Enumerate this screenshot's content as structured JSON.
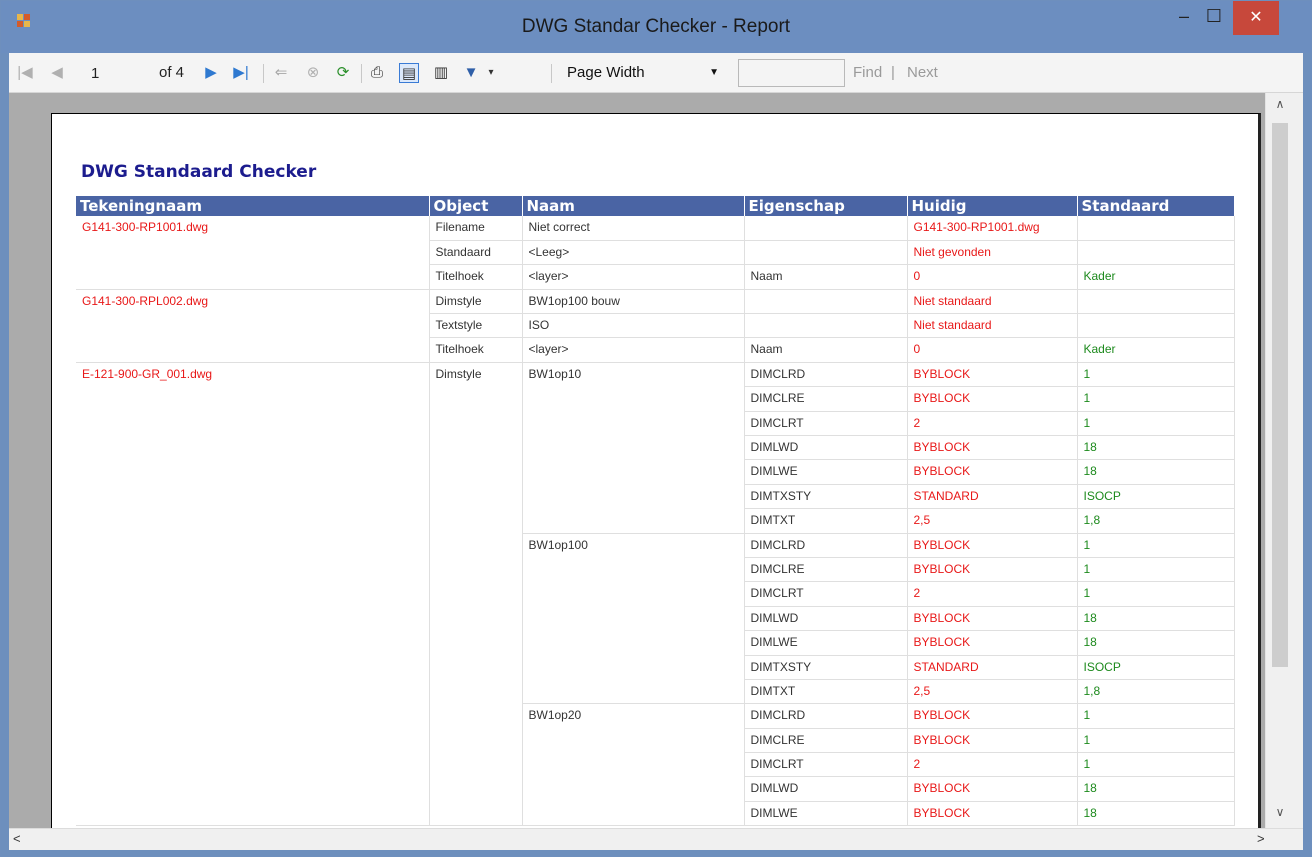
{
  "window": {
    "title": "DWG Standar Checker - Report",
    "close_symbol": "✕",
    "min_symbol": "–",
    "max_symbol": "☐"
  },
  "toolbar": {
    "current_page": "1",
    "page_count": "of 4",
    "zoom": "Page Width",
    "find_label": "Find",
    "find_separator": "|",
    "next_label": "Next"
  },
  "report": {
    "title": "DWG Standaard Checker",
    "columns": [
      "Tekeningnaam",
      "Object",
      "Naam",
      "Eigenschap",
      "Huidig",
      "Standaard"
    ],
    "rows": [
      [
        "G141-300-RP1001.dwg",
        "Filename",
        "Niet correct",
        "",
        "G141-300-RP1001.dwg",
        ""
      ],
      [
        "",
        "Standaard",
        "<Leeg>",
        "",
        "Niet gevonden",
        ""
      ],
      [
        "",
        "Titelhoek",
        "<layer>",
        "Naam",
        "0",
        "Kader"
      ],
      [
        "G141-300-RPL002.dwg",
        "Dimstyle",
        "BW1op100 bouw",
        "",
        "Niet standaard",
        ""
      ],
      [
        "",
        "Textstyle",
        "ISO",
        "",
        "Niet standaard",
        ""
      ],
      [
        "",
        "Titelhoek",
        "<layer>",
        "Naam",
        "0",
        "Kader"
      ],
      [
        "E-121-900-GR_001.dwg",
        "Dimstyle",
        "BW1op10",
        "DIMCLRD",
        "BYBLOCK",
        "1"
      ],
      [
        "",
        "",
        "",
        "DIMCLRE",
        "BYBLOCK",
        "1"
      ],
      [
        "",
        "",
        "",
        "DIMCLRT",
        "2",
        "1"
      ],
      [
        "",
        "",
        "",
        "DIMLWD",
        "BYBLOCK",
        "18"
      ],
      [
        "",
        "",
        "",
        "DIMLWE",
        "BYBLOCK",
        "18"
      ],
      [
        "",
        "",
        "",
        "DIMTXSTY",
        "STANDARD",
        "ISOCP"
      ],
      [
        "",
        "",
        "",
        "DIMTXT",
        "2,5",
        "1,8"
      ],
      [
        "",
        "",
        "BW1op100",
        "DIMCLRD",
        "BYBLOCK",
        "1"
      ],
      [
        "",
        "",
        "",
        "DIMCLRE",
        "BYBLOCK",
        "1"
      ],
      [
        "",
        "",
        "",
        "DIMCLRT",
        "2",
        "1"
      ],
      [
        "",
        "",
        "",
        "DIMLWD",
        "BYBLOCK",
        "18"
      ],
      [
        "",
        "",
        "",
        "DIMLWE",
        "BYBLOCK",
        "18"
      ],
      [
        "",
        "",
        "",
        "DIMTXSTY",
        "STANDARD",
        "ISOCP"
      ],
      [
        "",
        "",
        "",
        "DIMTXT",
        "2,5",
        "1,8"
      ],
      [
        "",
        "",
        "BW1op20",
        "DIMCLRD",
        "BYBLOCK",
        "1"
      ],
      [
        "",
        "",
        "",
        "DIMCLRE",
        "BYBLOCK",
        "1"
      ],
      [
        "",
        "",
        "",
        "DIMCLRT",
        "2",
        "1"
      ],
      [
        "",
        "",
        "",
        "DIMLWD",
        "BYBLOCK",
        "18"
      ],
      [
        "",
        "",
        "",
        "DIMLWE",
        "BYBLOCK",
        "18"
      ]
    ]
  },
  "colors": {
    "header_bg": "#4a64a4",
    "title": "#1c1c8e",
    "error": "#e81818",
    "standard": "#1d8a1d",
    "titlebar": "#6c8ec0",
    "close": "#c7483b"
  }
}
